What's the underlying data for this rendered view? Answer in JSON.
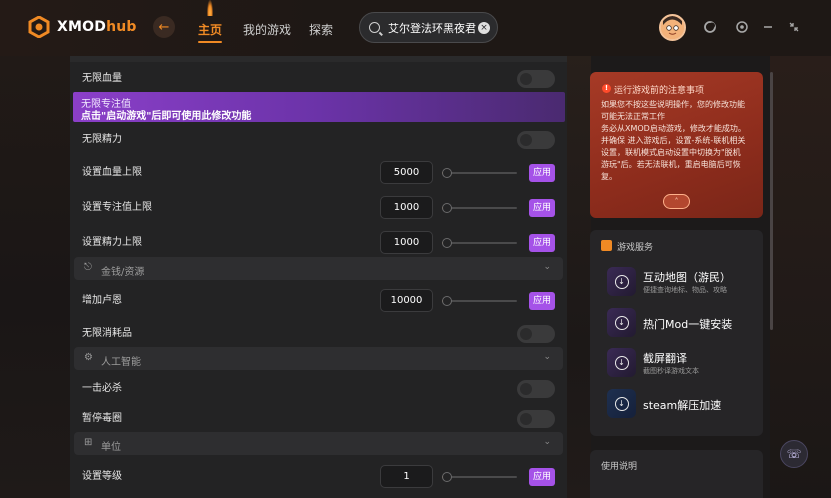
{
  "header": {
    "logo_prefix": "XMOD",
    "logo_suffix": "hub",
    "back_icon": "arrow-left-icon",
    "nav": [
      {
        "label": "主页",
        "active": true
      },
      {
        "label": "我的游戏",
        "active": false
      },
      {
        "label": "探索",
        "active": false
      }
    ],
    "search_value": "艾尔登法环黑夜君临",
    "window_controls": [
      "moon-icon",
      "settings-icon",
      "minimize-icon",
      "shrink-icon"
    ]
  },
  "main": {
    "rows": [
      {
        "type": "toggle",
        "label": "无限血量",
        "on": false
      },
      {
        "type": "tip",
        "title": "无限专注值",
        "body": "点击\"启动游戏\"后即可使用此修改功能"
      },
      {
        "type": "toggle",
        "label": "无限精力",
        "on": false
      },
      {
        "type": "slider",
        "label": "设置血量上限",
        "value": "5000",
        "level": 0.0,
        "button": "应用"
      },
      {
        "type": "slider",
        "label": "设置专注值上限",
        "value": "1000",
        "level": 0.0,
        "button": "应用"
      },
      {
        "type": "slider",
        "label": "设置精力上限",
        "value": "1000",
        "level": 0.0,
        "button": "应用"
      },
      {
        "type": "section",
        "label": "金钱/资源",
        "icon": "mouse-icon"
      },
      {
        "type": "slider",
        "label": "增加卢恩",
        "value": "10000",
        "level": 0.0,
        "button": "应用"
      },
      {
        "type": "toggle",
        "label": "无限消耗品",
        "on": false
      },
      {
        "type": "section",
        "label": "人工智能",
        "icon": "robot-icon"
      },
      {
        "type": "toggle",
        "label": "一击必杀",
        "on": false
      },
      {
        "type": "toggle",
        "label": "暂停毒圈",
        "on": false
      },
      {
        "type": "section",
        "label": "单位",
        "icon": "unit-icon"
      },
      {
        "type": "slider",
        "label": "设置等级",
        "value": "1",
        "level": 0.0,
        "button": "应用"
      }
    ]
  },
  "notice": {
    "title": "运行游戏前的注意事项",
    "lines": [
      "如果您不按这些说明操作，您的修改功能",
      "可能无法正常工作",
      "务必从XMOD启动游戏，修改才能成功。",
      "并确保 进入游戏后，设置-系统-联机相关",
      "设置，联机模式启动设置中切换为\"脱机",
      "游玩\"后。若无法联机，重启电脑后可恢",
      "复。"
    ],
    "expand_icon": "chevron-up-icon"
  },
  "services": {
    "title": "游戏服务",
    "items": [
      {
        "title": "互动地图（游民）",
        "subtitle": "便捷查询地标、物品、攻略"
      },
      {
        "title": "热门Mod一键安装",
        "subtitle": ""
      },
      {
        "title": "截屏翻译",
        "subtitle": "截图秒译游戏文本"
      },
      {
        "title": "steam解压加速",
        "subtitle": ""
      }
    ]
  },
  "usage": {
    "title": "使用说明"
  },
  "colors": {
    "accent": "#f08a24",
    "apply": "#a552e8",
    "notice": "#a63a26"
  }
}
